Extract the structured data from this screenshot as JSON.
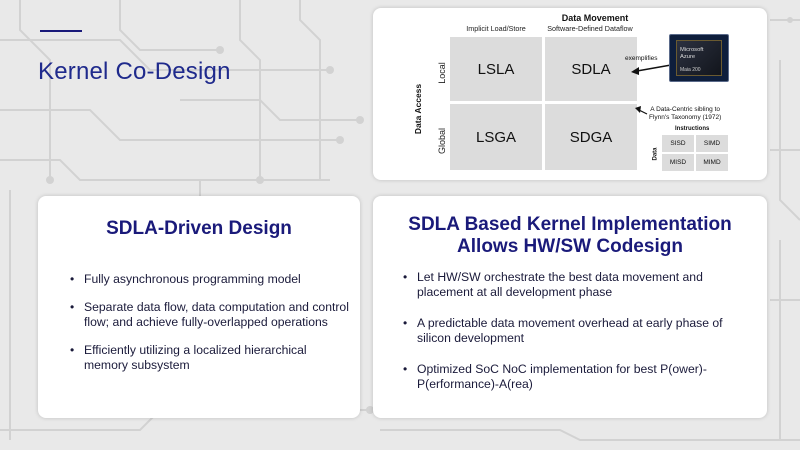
{
  "slide": {
    "title": "Kernel Co-Design"
  },
  "diagram": {
    "title": "Data Movement",
    "col_labels": [
      "Implicit Load/Store",
      "Software-Defined Dataflow"
    ],
    "axis_label": "Data Access",
    "row_labels": [
      "Local",
      "Global"
    ],
    "cells": [
      "LSLA",
      "SDLA",
      "LSGA",
      "SDGA"
    ],
    "arrow_label": "exemplifies",
    "chip": {
      "brand_line1": "Microsoft",
      "brand_line2": "Azure",
      "model": "Maia 200"
    },
    "taxonomy_note_line1": "A Data-Centric sibling to",
    "taxonomy_note_line2": "Flynn's Taxonomy (1972)",
    "flynn": {
      "col_label": "Instructions",
      "row_label": "Data",
      "cells": [
        "SISD",
        "SIMD",
        "MISD",
        "MIMD"
      ]
    }
  },
  "left_card": {
    "heading": "SDLA-Driven Design",
    "bullets": [
      "Fully asynchronous programming model",
      "Separate data flow, data computation and control flow; and achieve fully-overlapped operations",
      "Efficiently utilizing a localized hierarchical memory subsystem"
    ]
  },
  "right_card": {
    "heading_line1": "SDLA Based Kernel Implementation",
    "heading_line2": "Allows HW/SW Codesign",
    "bullets": [
      "Let HW/SW orchestrate the best data movement and placement at all development phase",
      "A predictable data movement overhead at early phase of silicon development",
      "Optimized SoC NoC implementation for best P(ower)-P(erformance)-A(rea)"
    ]
  },
  "colors": {
    "accent": "#1f2a8c",
    "heading": "#1a1a7a",
    "background": "#e9e9e9",
    "cell": "#dcdcdc"
  },
  "icons": {
    "bullet": "•",
    "circuit_background": "circuit-board-pattern"
  }
}
